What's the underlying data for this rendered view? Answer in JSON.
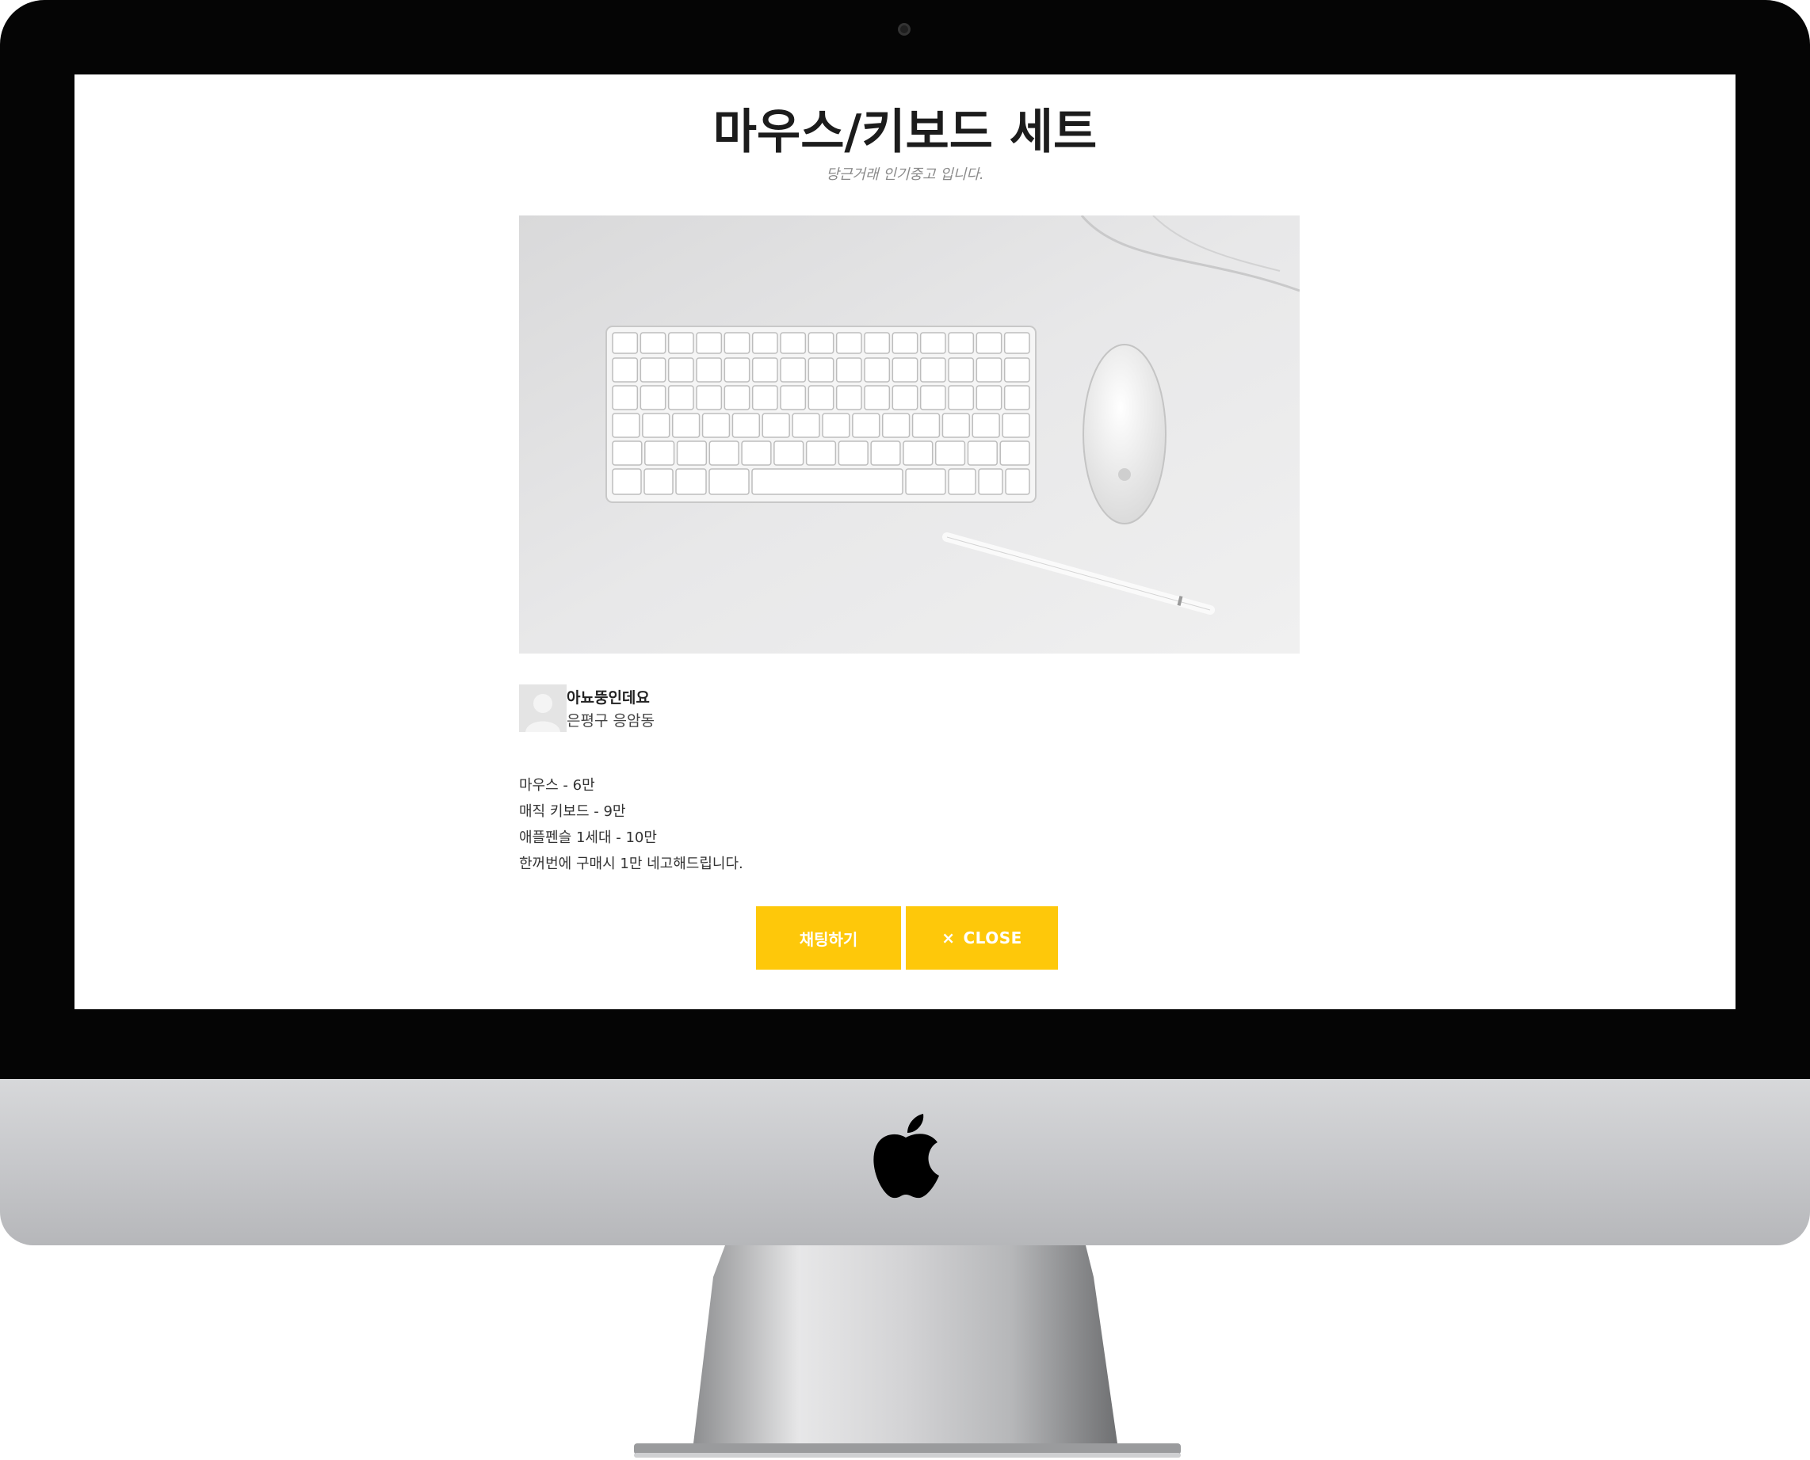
{
  "listing": {
    "title": "마우스/키보드 세트",
    "subtitle": "당근거래 인기중고 입니다."
  },
  "seller": {
    "name": "아뇨뚱인데요",
    "location": "은평구 응암동"
  },
  "description": [
    "마우스 - 6만",
    "매직 키보드 - 9만",
    "애플펜슬 1세대 - 10만",
    "한꺼번에 구매시 1만 네고해드립니다."
  ],
  "actions": {
    "chat_label": "채팅하기",
    "close_icon": "×",
    "close_label": "CLOSE"
  },
  "colors": {
    "accent": "#fec80a",
    "bezel": "#050505",
    "title": "#1c1c1c"
  },
  "icons": {
    "device": "apple-logo-icon",
    "avatar": "user-avatar-icon",
    "close": "close-icon"
  }
}
